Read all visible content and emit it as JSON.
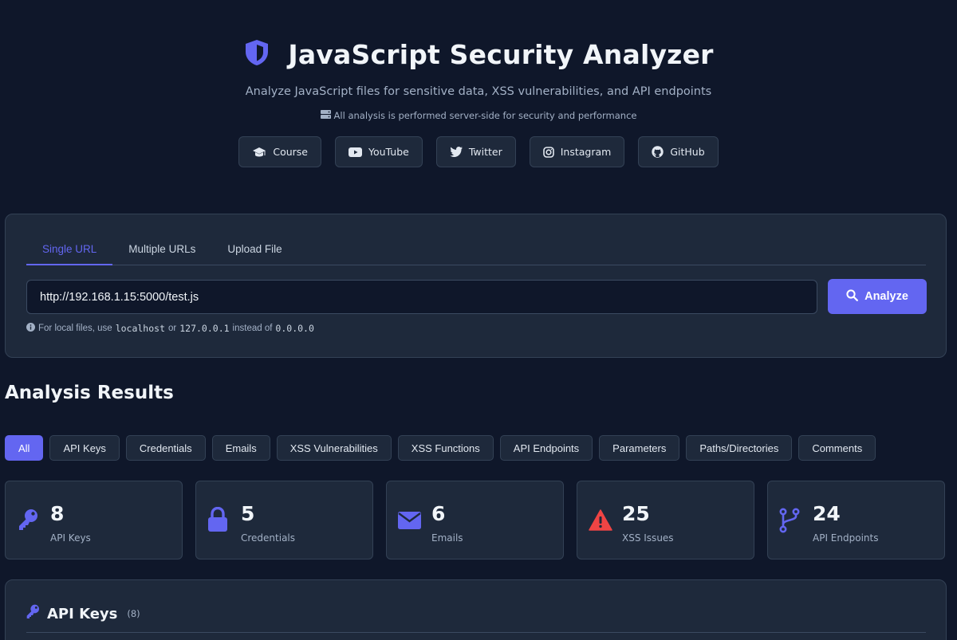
{
  "header": {
    "title": "JavaScript Security Analyzer",
    "subtitle": "Analyze JavaScript files for sensitive data, XSS vulnerabilities, and API endpoints",
    "note": "All analysis is performed server-side for security and performance",
    "links": [
      {
        "label": "Course",
        "icon": "graduation-cap-icon"
      },
      {
        "label": "YouTube",
        "icon": "youtube-icon"
      },
      {
        "label": "Twitter",
        "icon": "twitter-icon"
      },
      {
        "label": "Instagram",
        "icon": "instagram-icon"
      },
      {
        "label": "GitHub",
        "icon": "github-icon"
      }
    ]
  },
  "input": {
    "tabs": [
      "Single URL",
      "Multiple URLs",
      "Upload File"
    ],
    "active_tab": "Single URL",
    "url_value": "http://192.168.1.15:5000/test.js",
    "analyze_label": "Analyze",
    "hint_prefix": "For local files, use",
    "hint_code1": "localhost",
    "hint_or": "or",
    "hint_code2": "127.0.0.1",
    "hint_instead": "instead of",
    "hint_code3": "0.0.0.0"
  },
  "results": {
    "title": "Analysis Results",
    "filters": [
      "All",
      "API Keys",
      "Credentials",
      "Emails",
      "XSS Vulnerabilities",
      "XSS Functions",
      "API Endpoints",
      "Parameters",
      "Paths/Directories",
      "Comments"
    ],
    "active_filter": "All",
    "stats": [
      {
        "value": "8",
        "label": "API Keys",
        "icon": "key-icon"
      },
      {
        "value": "5",
        "label": "Credentials",
        "icon": "lock-icon"
      },
      {
        "value": "6",
        "label": "Emails",
        "icon": "envelope-icon"
      },
      {
        "value": "25",
        "label": "XSS Issues",
        "icon": "warning-icon"
      },
      {
        "value": "24",
        "label": "API Endpoints",
        "icon": "branch-icon"
      }
    ],
    "section": {
      "title": "API Keys",
      "count": "(8)"
    }
  },
  "colors": {
    "background": "#0f172a",
    "card": "#1e293b",
    "accent": "#6366f1",
    "danger": "#ef4444"
  }
}
